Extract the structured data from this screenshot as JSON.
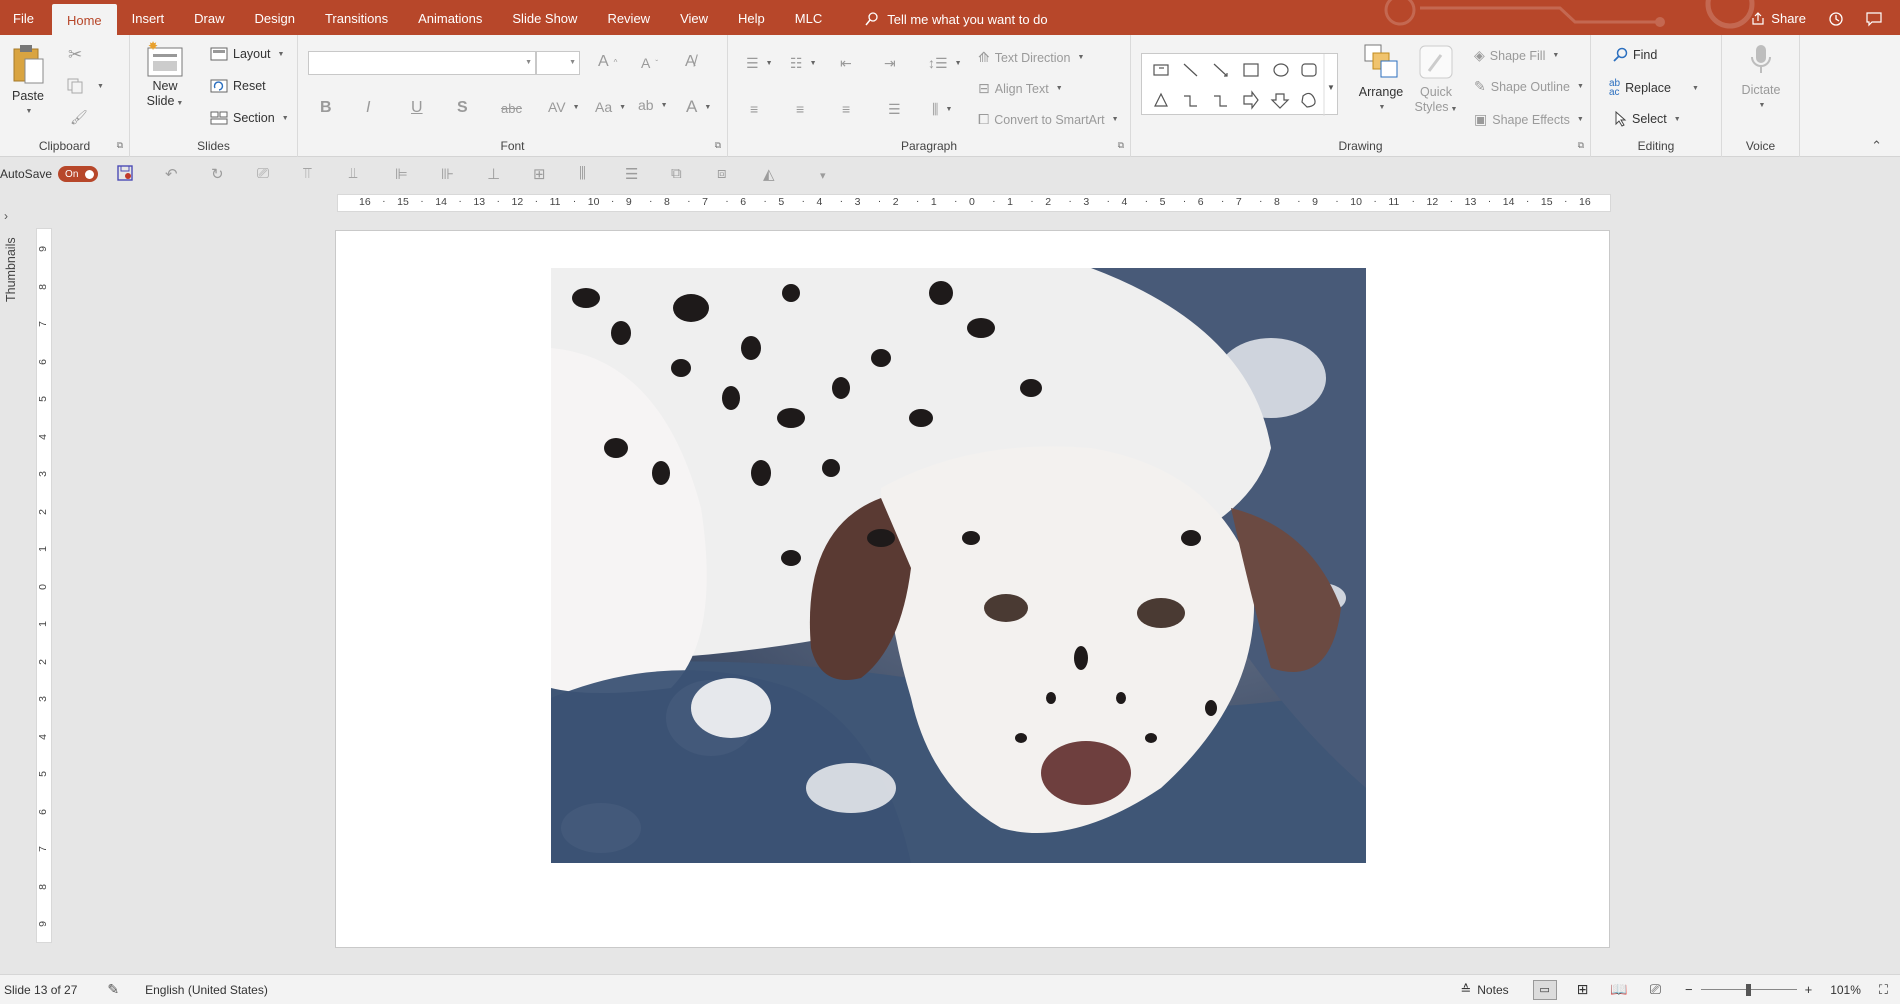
{
  "tabs": [
    {
      "id": "file",
      "label": "File"
    },
    {
      "id": "home",
      "label": "Home"
    },
    {
      "id": "insert",
      "label": "Insert"
    },
    {
      "id": "draw",
      "label": "Draw"
    },
    {
      "id": "design",
      "label": "Design"
    },
    {
      "id": "transitions",
      "label": "Transitions"
    },
    {
      "id": "animations",
      "label": "Animations"
    },
    {
      "id": "slideshow",
      "label": "Slide Show"
    },
    {
      "id": "review",
      "label": "Review"
    },
    {
      "id": "view",
      "label": "View"
    },
    {
      "id": "help",
      "label": "Help"
    },
    {
      "id": "mlc",
      "label": "MLC"
    }
  ],
  "tellme": {
    "placeholder": "Tell me what you want to do"
  },
  "share": {
    "label": "Share"
  },
  "ribbon": {
    "clipboard": {
      "label": "Clipboard",
      "paste": "Paste"
    },
    "slides": {
      "label": "Slides",
      "new_slide_line1": "New",
      "new_slide_line2": "Slide",
      "layout": "Layout",
      "reset": "Reset",
      "section": "Section"
    },
    "font": {
      "label": "Font",
      "font_name": "",
      "font_size": ""
    },
    "paragraph": {
      "label": "Paragraph",
      "text_direction": "Text Direction",
      "align_text": "Align Text",
      "convert_smartart": "Convert to SmartArt"
    },
    "drawing": {
      "label": "Drawing",
      "arrange": "Arrange",
      "quick_styles_line1": "Quick",
      "quick_styles_line2": "Styles",
      "shape_fill": "Shape Fill",
      "shape_outline": "Shape Outline",
      "shape_effects": "Shape Effects"
    },
    "editing": {
      "label": "Editing",
      "find": "Find",
      "replace": "Replace",
      "select": "Select"
    },
    "voice": {
      "label": "Voice",
      "dictate": "Dictate"
    }
  },
  "qat": {
    "autosave_label": "AutoSave",
    "autosave_state": "On"
  },
  "thumbnails": {
    "label": "Thumbnails"
  },
  "ruler": {
    "h_ticks": [
      "16",
      "15",
      "14",
      "13",
      "12",
      "11",
      "10",
      "9",
      "8",
      "7",
      "6",
      "5",
      "4",
      "3",
      "2",
      "1",
      "0",
      "1",
      "2",
      "3",
      "4",
      "5",
      "6",
      "7",
      "8",
      "9",
      "10",
      "11",
      "12",
      "13",
      "14",
      "15",
      "16"
    ],
    "v_ticks": [
      "9",
      "8",
      "7",
      "6",
      "5",
      "4",
      "3",
      "2",
      "1",
      "0",
      "1",
      "2",
      "3",
      "4",
      "5",
      "6",
      "7",
      "8",
      "9"
    ]
  },
  "status": {
    "slide_info": "Slide 13 of 27",
    "language": "English (United States)",
    "notes": "Notes",
    "zoom": "101%"
  },
  "colors": {
    "accent": "#b7472a",
    "ribbon_bg": "#f3f3f3",
    "canvas_bg": "#e6e6e6"
  },
  "slide": {
    "image_subject": "dalmatian puppy photo"
  }
}
